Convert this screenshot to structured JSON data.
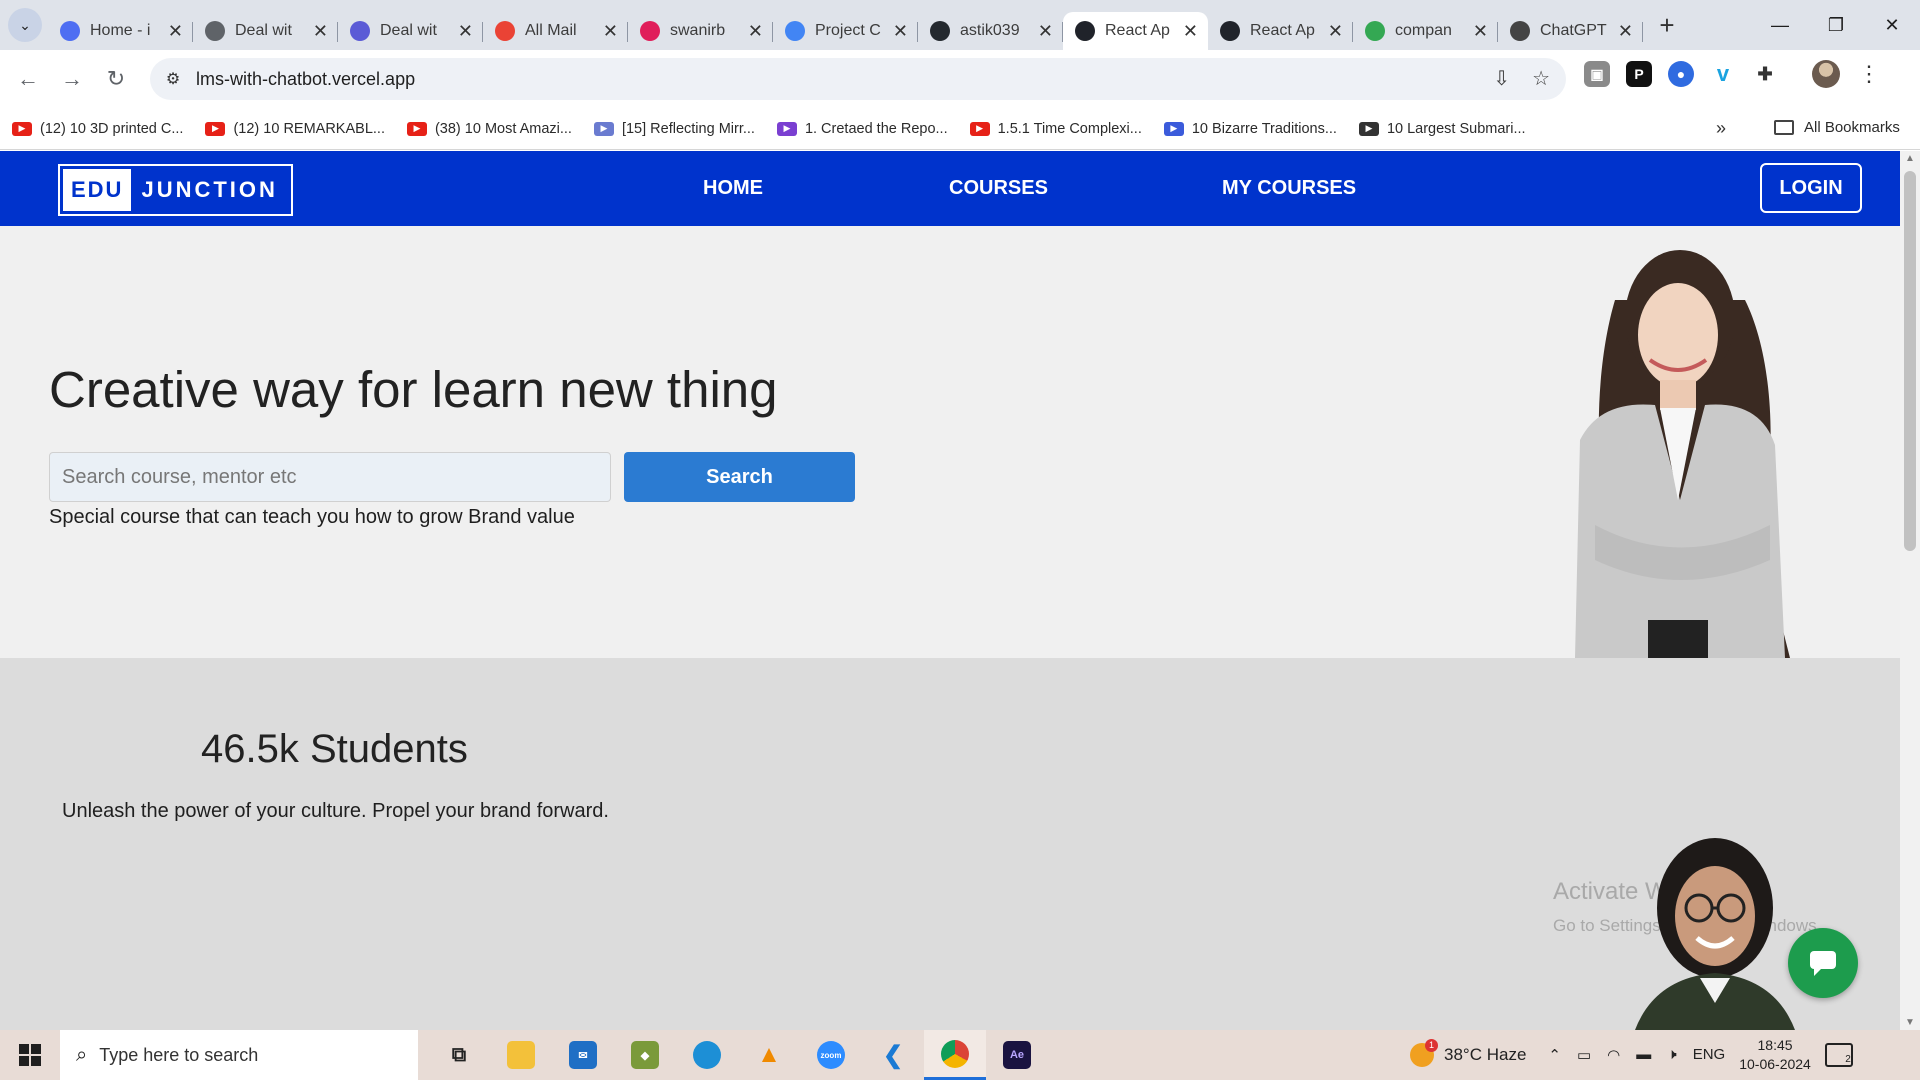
{
  "browser": {
    "tabs": [
      {
        "title": "Home - i",
        "color": "#4e6ef2",
        "active": false
      },
      {
        "title": "Deal wit",
        "color": "#5f6368",
        "active": false
      },
      {
        "title": "Deal wit",
        "color": "#5b5bd6",
        "active": false
      },
      {
        "title": "All Mail",
        "color": "#ea4335",
        "active": false
      },
      {
        "title": "swanirb",
        "color": "#e01e5a",
        "active": false
      },
      {
        "title": "Project C",
        "color": "#4285f4",
        "active": false
      },
      {
        "title": "astik039",
        "color": "#24292f",
        "active": false
      },
      {
        "title": "React Ap",
        "color": "#20232a",
        "active": true
      },
      {
        "title": "React Ap",
        "color": "#20232a",
        "active": false
      },
      {
        "title": "compan",
        "color": "#34a853",
        "active": false
      },
      {
        "title": "ChatGPT",
        "color": "#444444",
        "active": false
      }
    ],
    "url": "lms-with-chatbot.vercel.app",
    "bookmarks": [
      {
        "label": "(12) 10 3D printed C...",
        "color": "#e62117"
      },
      {
        "label": "(12) 10 REMARKABL...",
        "color": "#e62117"
      },
      {
        "label": "(38) 10 Most Amazi...",
        "color": "#e62117"
      },
      {
        "label": "[15] Reflecting Mirr...",
        "color": "#6a7bd0"
      },
      {
        "label": "1. Cretaed the Repo...",
        "color": "#7a3fd1"
      },
      {
        "label": "1.5.1 Time Complexi...",
        "color": "#e62117"
      },
      {
        "label": "10 Bizarre Traditions...",
        "color": "#3b5bdb"
      },
      {
        "label": "10 Largest Submari...",
        "color": "#333333"
      }
    ],
    "all_bookmarks": "All Bookmarks"
  },
  "site": {
    "logo_left": "EDU",
    "logo_right": "JUNCTION",
    "nav": [
      "HOME",
      "COURSES",
      "MY COURSES"
    ],
    "login": "LOGIN",
    "brand_color": "#0033cc"
  },
  "hero": {
    "title": "Creative way for learn new thing",
    "search_placeholder": "Search course, mentor etc",
    "search_button": "Search",
    "subtitle": "Special course that can teach you how to grow Brand value"
  },
  "stats": {
    "value": "46.5k Students",
    "tagline": "Unleash the power of your culture. Propel your brand forward."
  },
  "watermark": {
    "line1": "Activate Windows",
    "line2": "Go to Settings to activate Windows."
  },
  "taskbar": {
    "search_placeholder": "Type here to search",
    "weather": "38°C  Haze",
    "lang": "ENG",
    "time": "18:45",
    "date": "10-06-2024",
    "notifications": "2"
  }
}
